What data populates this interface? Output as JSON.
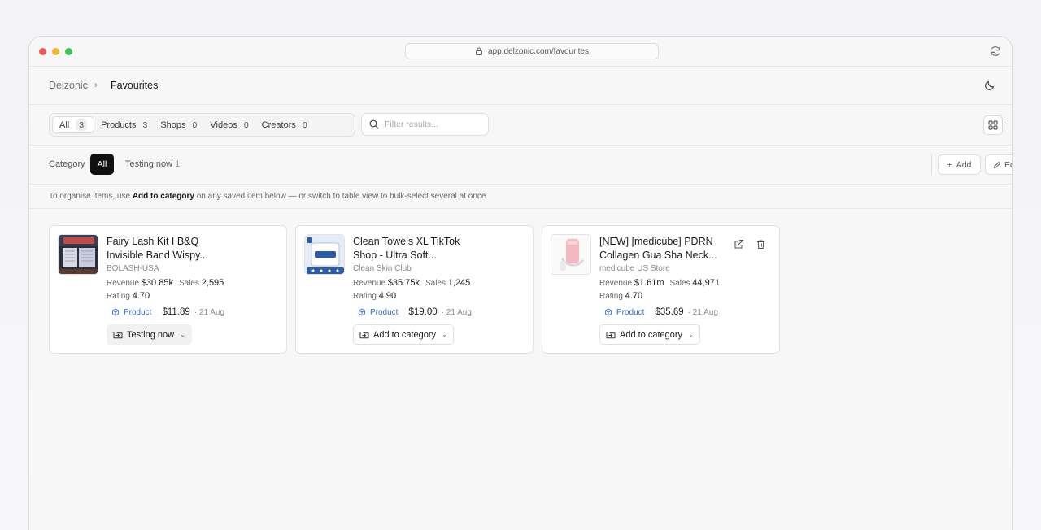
{
  "browser": {
    "url": "app.delzonic.com/favourites"
  },
  "breadcrumb": {
    "root": "Delzonic",
    "separator": "›",
    "current": "Favourites"
  },
  "tabs": [
    {
      "label": "All",
      "count": "3"
    },
    {
      "label": "Products",
      "count": "3"
    },
    {
      "label": "Shops",
      "count": "0"
    },
    {
      "label": "Videos",
      "count": "0"
    },
    {
      "label": "Creators",
      "count": "0"
    }
  ],
  "filter": {
    "placeholder": "Filter results..."
  },
  "category": {
    "label": "Category",
    "all": "All",
    "testing": "Testing now",
    "testing_count": "1",
    "add": "Add",
    "edit": "Edit"
  },
  "hint": {
    "pre": "To organise items, use ",
    "bold": "Add to category",
    "post": " on any saved item below — or switch to table view to bulk-select several at once."
  },
  "cards": [
    {
      "title": "Fairy Lash Kit I B&Q Invisible Band Wispy...",
      "shop": "BQLASH-USA",
      "revenue_label": "Revenue",
      "revenue": "$30.85k",
      "sales_label": "Sales",
      "sales": "2,595",
      "rating_label": "Rating",
      "rating": "4.70",
      "type": "Product",
      "price": "$11.89",
      "date": "· 21 Aug",
      "category_button": "Testing now"
    },
    {
      "title": "Clean Towels XL TikTok Shop - Ultra Soft...",
      "shop": "Clean Skin Club",
      "revenue_label": "Revenue",
      "revenue": "$35.75k",
      "sales_label": "Sales",
      "sales": "1,245",
      "rating_label": "Rating",
      "rating": "4.90",
      "type": "Product",
      "price": "$19.00",
      "date": "· 21 Aug",
      "category_button": "Add to category"
    },
    {
      "title": "[NEW] [medicube] PDRN Collagen Gua Sha Neck...",
      "shop": "medicube US Store",
      "revenue_label": "Revenue",
      "revenue": "$1.61m",
      "sales_label": "Sales",
      "sales": "44,971",
      "rating_label": "Rating",
      "rating": "4.70",
      "type": "Product",
      "price": "$35.69",
      "date": "· 21 Aug",
      "category_button": "Add to category"
    }
  ],
  "icons": {
    "lock": "lock-icon",
    "refresh": "refresh-icon",
    "moon": "moon-icon",
    "search": "search-icon",
    "grid": "grid-icon",
    "cube": "cube-icon",
    "folder": "folder-icon",
    "external": "external-link-icon",
    "trash": "trash-icon"
  },
  "colors": {
    "accent_blue": "#2f6fd8",
    "active_black": "#111111"
  }
}
